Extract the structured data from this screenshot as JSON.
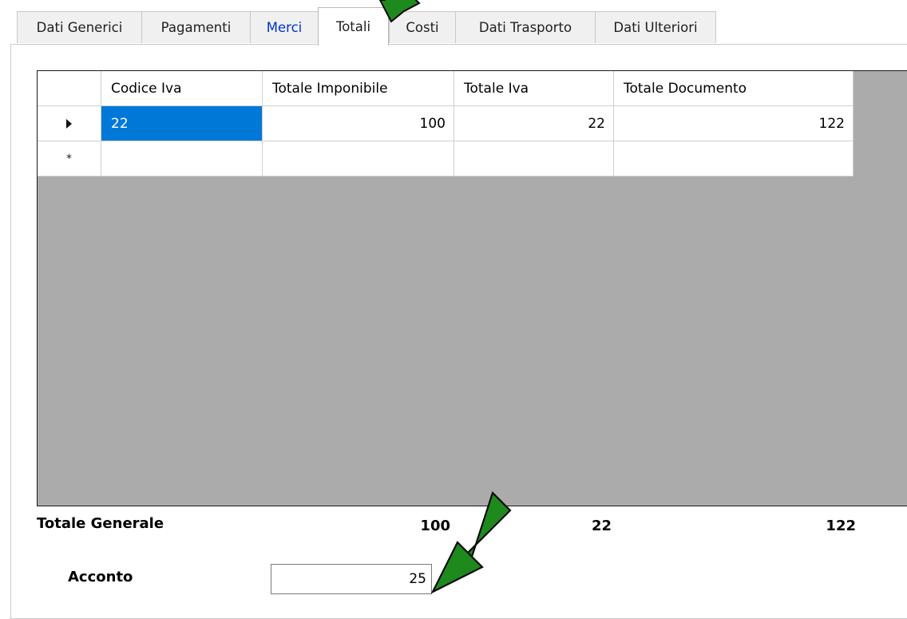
{
  "tabs": [
    {
      "label": "Dati Generici"
    },
    {
      "label": "Pagamenti"
    },
    {
      "label": "Merci"
    },
    {
      "label": "Totali"
    },
    {
      "label": "Costi"
    },
    {
      "label": "Dati Trasporto"
    },
    {
      "label": "Dati Ulteriori"
    }
  ],
  "grid": {
    "columns": [
      "Codice Iva",
      "Totale Imponibile",
      "Totale Iva",
      "Totale Documento"
    ],
    "rows": [
      {
        "codice_iva": "22",
        "totale_imponibile": "100",
        "totale_iva": "22",
        "totale_documento": "122"
      }
    ],
    "new_row_marker": "*"
  },
  "totals": {
    "label": "Totale Generale",
    "imponibile": "100",
    "iva": "22",
    "documento": "122"
  },
  "acconto": {
    "label": "Acconto",
    "value": "25"
  },
  "colors": {
    "selection": "#0078d7",
    "grid_background": "#ababab",
    "annotation_arrow": "#1e8a1e"
  }
}
